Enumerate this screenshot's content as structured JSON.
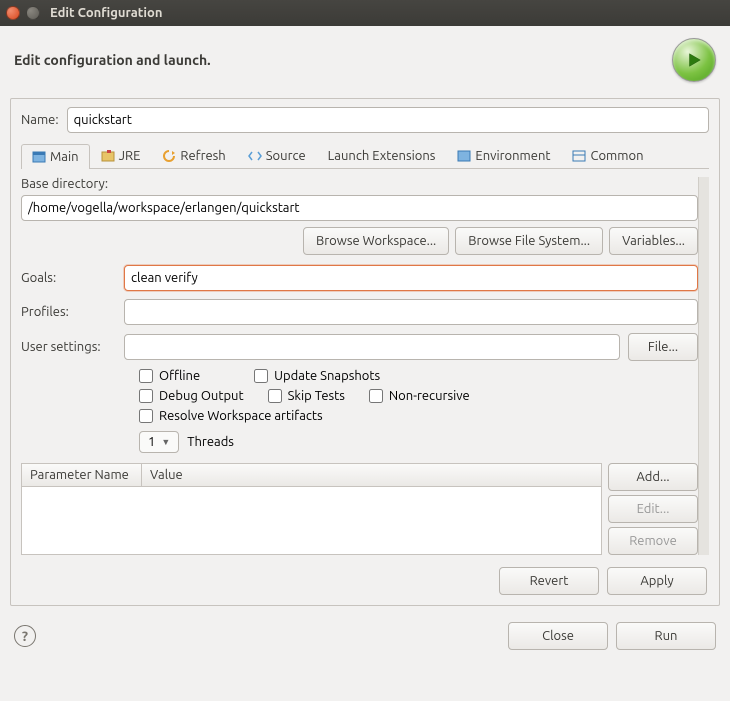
{
  "window": {
    "title": "Edit Configuration"
  },
  "header": {
    "title": "Edit configuration and launch."
  },
  "name": {
    "label": "Name:",
    "value": "quickstart"
  },
  "tabs": [
    {
      "label": "Main",
      "active": true
    },
    {
      "label": "JRE"
    },
    {
      "label": "Refresh"
    },
    {
      "label": "Source"
    },
    {
      "label": "Launch Extensions"
    },
    {
      "label": "Environment"
    },
    {
      "label": "Common"
    }
  ],
  "base_dir": {
    "label": "Base directory:",
    "value": "/home/vogella/workspace/erlangen/quickstart",
    "browse_ws": "Browse Workspace...",
    "browse_fs": "Browse File System...",
    "variables": "Variables..."
  },
  "goals": {
    "label": "Goals:",
    "value": "clean verify"
  },
  "profiles": {
    "label": "Profiles:",
    "value": ""
  },
  "user_settings": {
    "label": "User settings:",
    "value": "",
    "file_btn": "File..."
  },
  "checks": {
    "offline": "Offline",
    "update": "Update Snapshots",
    "debug": "Debug Output",
    "skip": "Skip Tests",
    "nonrec": "Non-recursive",
    "resolve": "Resolve Workspace artifacts"
  },
  "threads": {
    "value": "1",
    "label": "Threads"
  },
  "table": {
    "col1": "Parameter Name",
    "col2": "Value",
    "add": "Add...",
    "edit": "Edit...",
    "remove": "Remove"
  },
  "actions": {
    "revert": "Revert",
    "apply": "Apply"
  },
  "footer": {
    "close": "Close",
    "run": "Run"
  }
}
